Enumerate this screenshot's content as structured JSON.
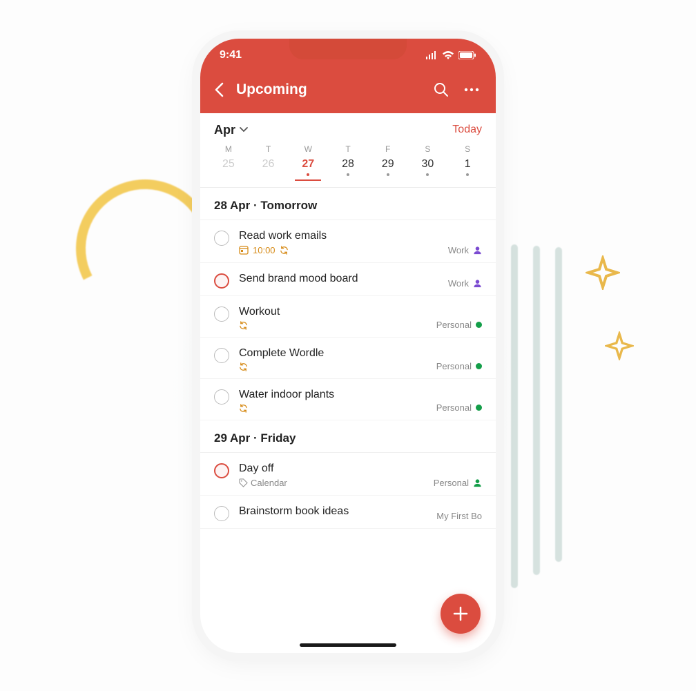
{
  "status": {
    "time": "9:41"
  },
  "header": {
    "title": "Upcoming"
  },
  "month": {
    "label": "Apr",
    "today_label": "Today"
  },
  "week": [
    {
      "dow": "M",
      "num": "25",
      "muted": true
    },
    {
      "dow": "T",
      "num": "26",
      "muted": true
    },
    {
      "dow": "W",
      "num": "27",
      "selected": true,
      "dot": true
    },
    {
      "dow": "T",
      "num": "28",
      "dot": true
    },
    {
      "dow": "F",
      "num": "29",
      "dot": true
    },
    {
      "dow": "S",
      "num": "30",
      "dot": true
    },
    {
      "dow": "S",
      "num": "1",
      "dot": true
    }
  ],
  "sections": [
    {
      "header": "28 Apr · Tomorrow",
      "tasks": [
        {
          "title": "Read work emails",
          "time": "10:00",
          "recurring": true,
          "project": "Work",
          "project_style": "person",
          "priority": false,
          "has_calendar_icon": true
        },
        {
          "title": "Send brand mood board",
          "project": "Work",
          "project_style": "person",
          "priority": true
        },
        {
          "title": "Workout",
          "recurring": true,
          "project": "Personal",
          "project_style": "green"
        },
        {
          "title": "Complete Wordle",
          "recurring": true,
          "project": "Personal",
          "project_style": "green"
        },
        {
          "title": "Water indoor plants",
          "recurring": true,
          "project": "Personal",
          "project_style": "green"
        }
      ]
    },
    {
      "header": "29 Apr · Friday",
      "tasks": [
        {
          "title": "Day off",
          "label": "Calendar",
          "project": "Personal",
          "project_style": "person-green",
          "priority": true
        },
        {
          "title": "Brainstorm book ideas",
          "project": "My First Bo"
        }
      ]
    }
  ],
  "colors": {
    "accent": "#db4c3f",
    "green": "#149e49",
    "purple": "#7b4bd1",
    "amber": "#d68b18"
  }
}
